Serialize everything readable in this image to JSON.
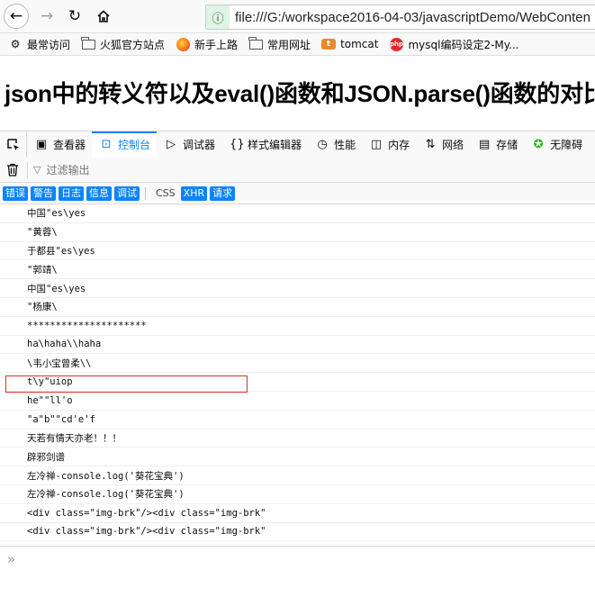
{
  "browser": {
    "url": "file:///G:/workspace2016-04-03/javascriptDemo/WebConten",
    "bookmarks": [
      "最常访问",
      "火狐官方站点",
      "新手上路",
      "常用网址",
      "tomcat",
      "mysql编码设定2-My..."
    ]
  },
  "page": {
    "heading": "json中的转义符以及eval()函数和JSON.parse()函数的对比"
  },
  "devtools": {
    "tabs": [
      {
        "label": "查看器",
        "icon": "inspector-icon"
      },
      {
        "label": "控制台",
        "icon": "console-icon",
        "active": true
      },
      {
        "label": "调试器",
        "icon": "debugger-icon"
      },
      {
        "label": "样式编辑器",
        "icon": "style-editor-icon"
      },
      {
        "label": "性能",
        "icon": "performance-icon"
      },
      {
        "label": "内存",
        "icon": "memory-icon"
      },
      {
        "label": "网络",
        "icon": "network-icon"
      },
      {
        "label": "存储",
        "icon": "storage-icon"
      },
      {
        "label": "无障碍",
        "icon": "accessibility-icon"
      }
    ],
    "filter_placeholder": "过滤输出",
    "categories": [
      {
        "label": "错误",
        "on": true
      },
      {
        "label": "警告",
        "on": true
      },
      {
        "label": "日志",
        "on": true
      },
      {
        "label": "信息",
        "on": true
      },
      {
        "label": "调试",
        "on": true
      },
      {
        "label": "CSS",
        "on": false
      },
      {
        "label": "XHR",
        "on": true
      },
      {
        "label": "请求",
        "on": true
      }
    ],
    "log_lines": [
      "中国\"es\\yes",
      "\"黄蓉\\",
      "于都县\"es\\yes",
      "\"郭靖\\",
      "中国\"es\\yes",
      "\"杨康\\",
      "*********************",
      "ha\\haha\\\\haha",
      "\\韦小宝曾柔\\\\",
      "t\\y\"uiop",
      "he\"\"ll'o",
      "\"a\"b\"\"cd'e'f",
      "天若有情天亦老！！！",
      "辟邪剑谱",
      "左冷禅-console.log('葵花宝典')",
      "左冷禅-console.log('葵花宝典')",
      "<div class=\"img-brk\"/><div class=\"img-brk\"",
      "<div class=\"img-brk\"/><div class=\"img-brk\""
    ],
    "prompt_symbol": "»"
  }
}
